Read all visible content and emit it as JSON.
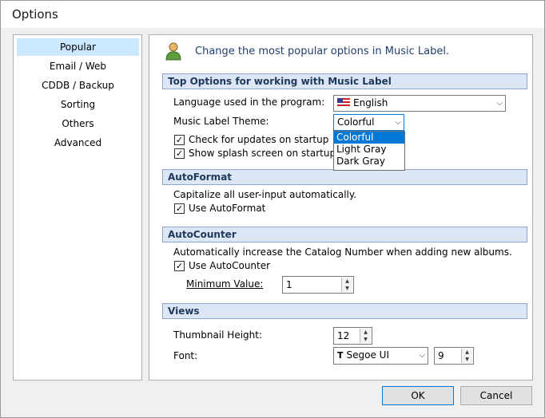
{
  "window": {
    "title": "Options"
  },
  "nav": {
    "items": [
      "Popular",
      "Email / Web",
      "CDDB / Backup",
      "Sorting",
      "Others",
      "Advanced"
    ],
    "active": "Popular"
  },
  "header": {
    "text": "Change the most popular options in Music Label.",
    "icon": "user-icon"
  },
  "sections": {
    "top": {
      "title": "Top Options for working with Music Label",
      "language_label": "Language used in the program:",
      "language_value": "English",
      "theme_label": "Music Label Theme:",
      "theme_value": "Colorful",
      "theme_options": [
        "Colorful",
        "Light Gray",
        "Dark Gray"
      ],
      "check_updates": "Check for updates on startup",
      "splash": "Show splash screen on startup"
    },
    "autoformat": {
      "title": "AutoFormat",
      "desc": "Capitalize all user-input automatically.",
      "use": "Use AutoFormat"
    },
    "autocounter": {
      "title": "AutoCounter",
      "desc": "Automatically increase the Catalog Number when adding new albums.",
      "use": "Use AutoCounter",
      "min_label": "Minimum Value:",
      "min_value": "1"
    },
    "views": {
      "title": "Views",
      "thumb_label": "Thumbnail Height:",
      "thumb_value": "12",
      "font_label": "Font:",
      "font_value": "Segoe UI",
      "font_size": "9"
    }
  },
  "buttons": {
    "ok": "OK",
    "cancel": "Cancel"
  },
  "colors": {
    "accent": "#0078d7",
    "section_bg": "#dce6f4",
    "nav_selected": "#cce8ff"
  }
}
